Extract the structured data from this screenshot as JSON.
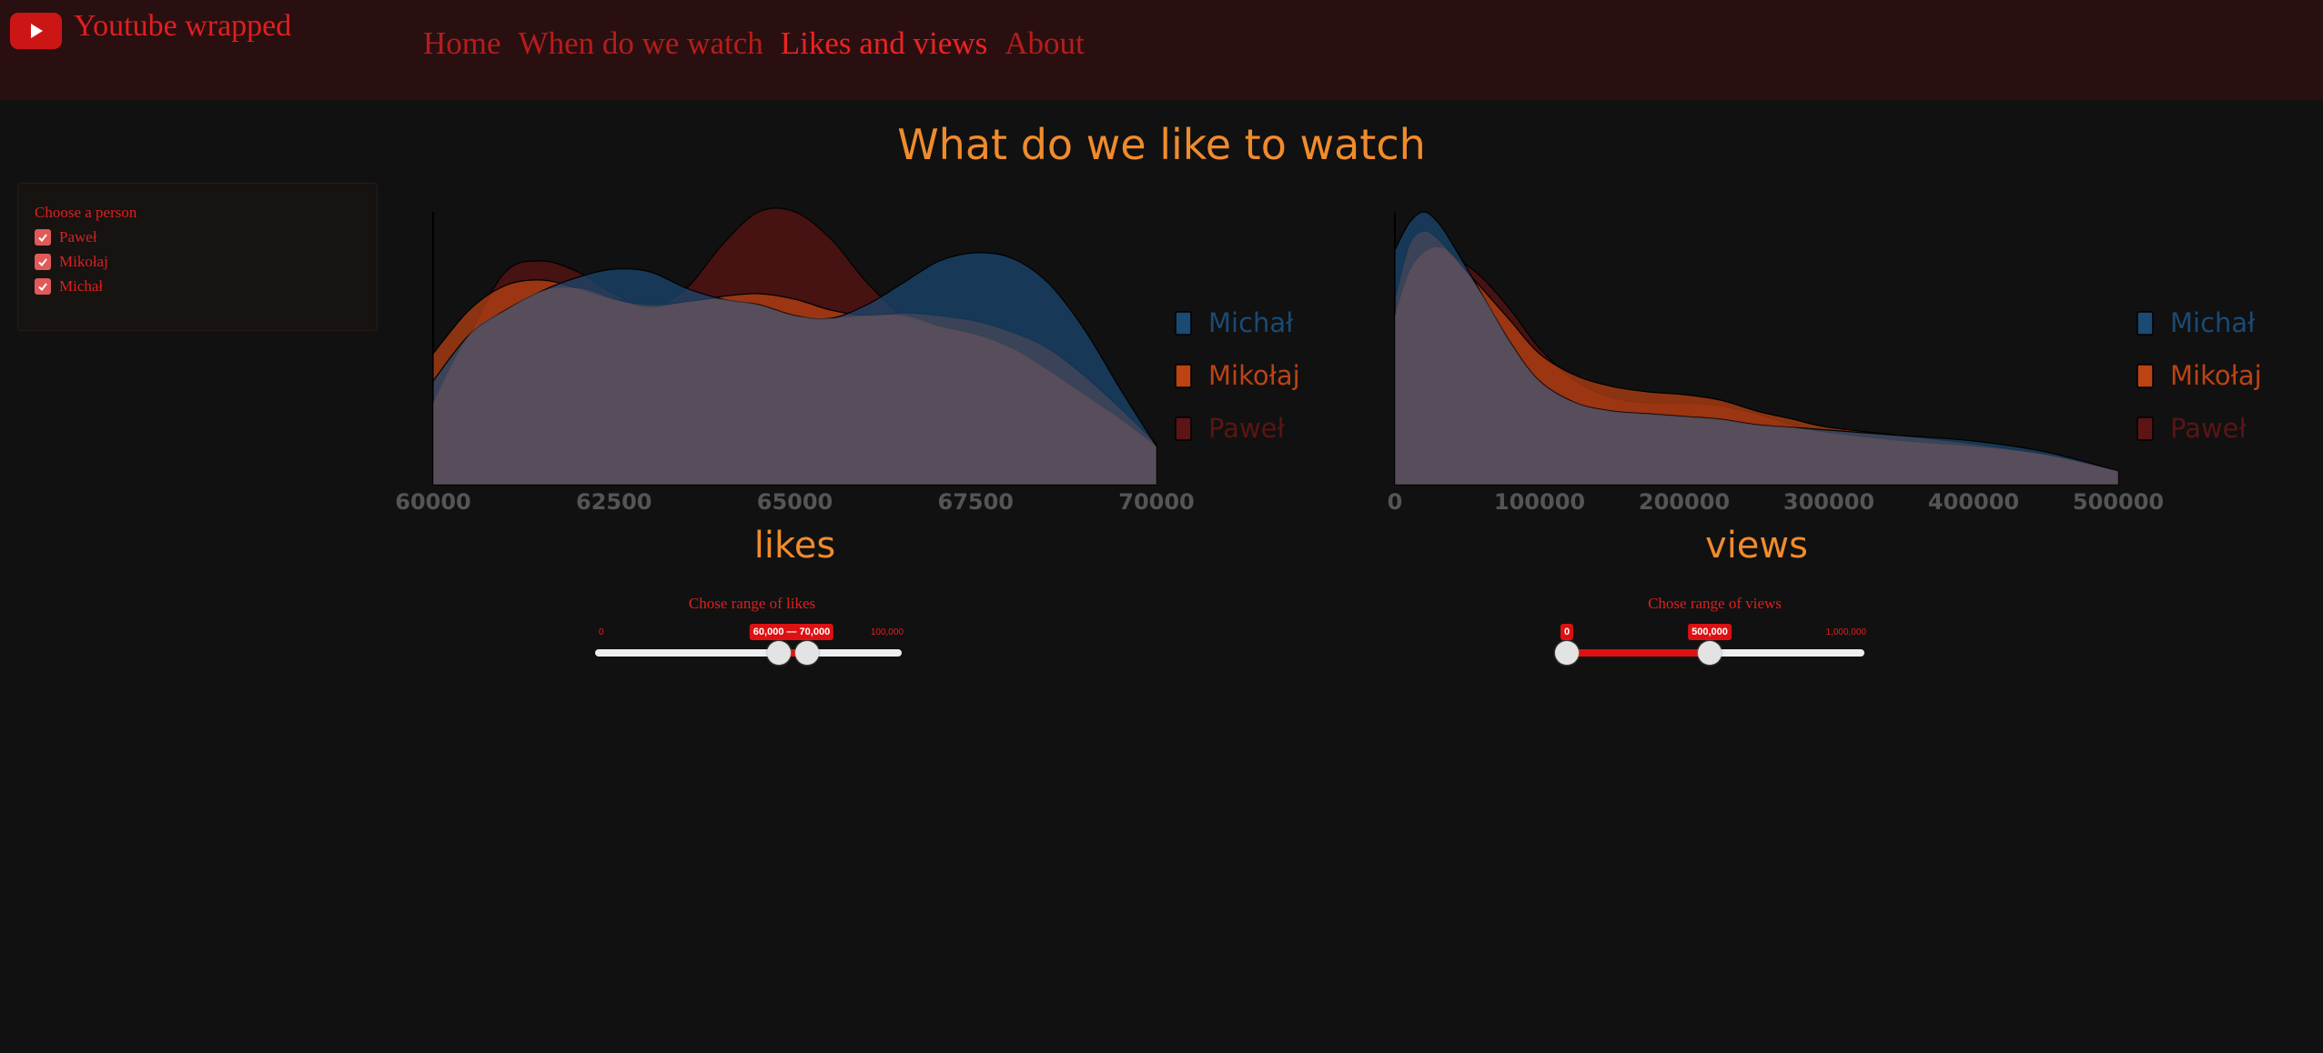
{
  "app": {
    "title": "Youtube wrapped"
  },
  "nav": {
    "items": [
      "Home",
      "When do we watch",
      "Likes and views",
      "About"
    ],
    "active": "Likes and views"
  },
  "page": {
    "title": "What do we like to watch"
  },
  "filter": {
    "title": "Choose a person",
    "options": [
      {
        "label": "Paweł",
        "checked": true
      },
      {
        "label": "Mikołaj",
        "checked": true
      },
      {
        "label": "Michał",
        "checked": true
      }
    ]
  },
  "colors": {
    "Michał": "#1b4a73",
    "Mikołaj": "#bc4312",
    "Paweł": "#5c1414",
    "accent": "#f08b2c",
    "brand": "#e01f1f"
  },
  "chart_data": [
    {
      "type": "area",
      "xlabel": "likes",
      "xlim": [
        60000,
        70000
      ],
      "xticks": [
        "60000",
        "62500",
        "65000",
        "67500",
        "70000"
      ],
      "grid": false,
      "legend_position": "right",
      "x": [
        60000,
        60500,
        61000,
        61500,
        62000,
        62500,
        63000,
        63500,
        64000,
        64500,
        65000,
        65500,
        66000,
        66500,
        67000,
        67500,
        68000,
        68500,
        69000,
        69500,
        70000
      ],
      "series": [
        {
          "name": "Michał",
          "values": [
            0.38,
            0.55,
            0.64,
            0.71,
            0.76,
            0.79,
            0.78,
            0.72,
            0.68,
            0.66,
            0.62,
            0.61,
            0.66,
            0.74,
            0.82,
            0.85,
            0.83,
            0.74,
            0.57,
            0.35,
            0.14
          ]
        },
        {
          "name": "Mikołaj",
          "values": [
            0.48,
            0.64,
            0.73,
            0.75,
            0.72,
            0.68,
            0.66,
            0.67,
            0.69,
            0.7,
            0.68,
            0.64,
            0.62,
            0.63,
            0.62,
            0.6,
            0.56,
            0.5,
            0.4,
            0.28,
            0.15
          ]
        },
        {
          "name": "Paweł",
          "values": [
            0.3,
            0.55,
            0.78,
            0.82,
            0.78,
            0.7,
            0.65,
            0.72,
            0.88,
            1.0,
            1.0,
            0.9,
            0.74,
            0.62,
            0.58,
            0.55,
            0.5,
            0.42,
            0.33,
            0.24,
            0.15
          ]
        }
      ],
      "value_unit": "relative density"
    },
    {
      "type": "area",
      "xlabel": "views",
      "xlim": [
        0,
        500000
      ],
      "xticks": [
        "0",
        "100000",
        "200000",
        "300000",
        "400000",
        "500000"
      ],
      "grid": false,
      "legend_position": "right",
      "x": [
        0,
        10000,
        20000,
        30000,
        40000,
        60000,
        80000,
        100000,
        125000,
        150000,
        175000,
        200000,
        225000,
        250000,
        275000,
        300000,
        350000,
        400000,
        450000,
        500000
      ],
      "series": [
        {
          "name": "Michał",
          "values": [
            0.86,
            0.96,
            1.0,
            0.96,
            0.88,
            0.7,
            0.52,
            0.38,
            0.3,
            0.27,
            0.26,
            0.25,
            0.24,
            0.22,
            0.21,
            0.2,
            0.18,
            0.16,
            0.12,
            0.05
          ]
        },
        {
          "name": "Mikołaj",
          "values": [
            0.68,
            0.88,
            0.93,
            0.9,
            0.84,
            0.72,
            0.6,
            0.48,
            0.4,
            0.36,
            0.34,
            0.33,
            0.31,
            0.27,
            0.24,
            0.21,
            0.18,
            0.15,
            0.11,
            0.05
          ]
        },
        {
          "name": "Paweł",
          "values": [
            0.62,
            0.78,
            0.85,
            0.87,
            0.84,
            0.76,
            0.64,
            0.5,
            0.38,
            0.32,
            0.3,
            0.3,
            0.29,
            0.26,
            0.22,
            0.19,
            0.16,
            0.14,
            0.11,
            0.05
          ]
        }
      ],
      "value_unit": "relative density"
    }
  ],
  "sliders": [
    {
      "title": "Chose range of likes",
      "min_label": "0",
      "max_label": "100,000",
      "min": 0,
      "max": 100000,
      "low": 60000,
      "high": 70000,
      "range_label": "60,000 — 70,000"
    },
    {
      "title": "Chose range of views",
      "min_label": "1,000,000",
      "max_label": "1,000,000",
      "min": 0,
      "max": 1000000,
      "low": 0,
      "high": 500000,
      "low_label": "0",
      "high_label": "500,000"
    }
  ]
}
